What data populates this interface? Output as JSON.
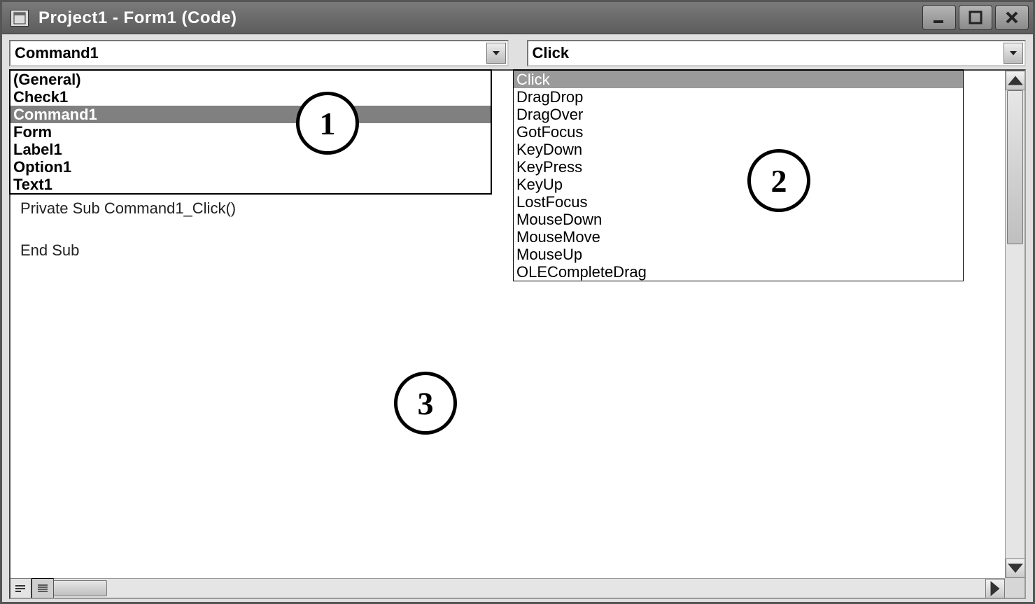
{
  "title": "Project1 - Form1 (Code)",
  "object_combo": {
    "value": "Command1",
    "options": [
      "(General)",
      "Check1",
      "Command1",
      "Form",
      "Label1",
      "Option1",
      "Text1"
    ],
    "selected_index": 2
  },
  "procedure_combo": {
    "value": "Click",
    "options": [
      "Click",
      "DragDrop",
      "DragOver",
      "GotFocus",
      "KeyDown",
      "KeyPress",
      "KeyUp",
      "LostFocus",
      "MouseDown",
      "MouseMove",
      "MouseUp",
      "OLECompleteDrag"
    ],
    "selected_index": 0
  },
  "code_lines": [
    "Private Sub Command1_Click()",
    "",
    "End Sub"
  ],
  "callouts": {
    "one": "1",
    "two": "2",
    "three": "3"
  }
}
